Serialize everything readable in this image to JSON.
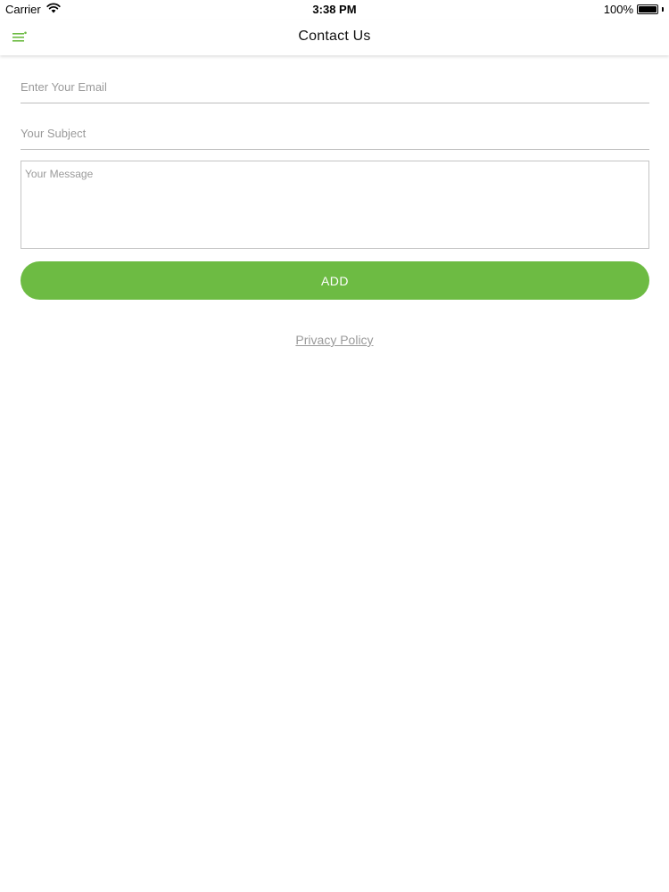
{
  "status_bar": {
    "carrier": "Carrier",
    "time": "3:38 PM",
    "battery_percent": "100%",
    "battery_level": 1.0,
    "icons": [
      "wifi-icon",
      "battery-icon"
    ]
  },
  "nav": {
    "title": "Contact Us",
    "menu_icon": "hamburger-menu-icon"
  },
  "form": {
    "email_placeholder": "Enter Your Email",
    "email_value": "",
    "subject_placeholder": "Your Subject",
    "subject_value": "",
    "message_placeholder": "Your Message",
    "message_value": "",
    "submit_label": "ADD"
  },
  "footer": {
    "privacy_label": "Privacy Policy"
  },
  "colors": {
    "accent": "#6dbb43",
    "placeholder": "#9a9a9a",
    "divider": "#bdbdbd"
  }
}
